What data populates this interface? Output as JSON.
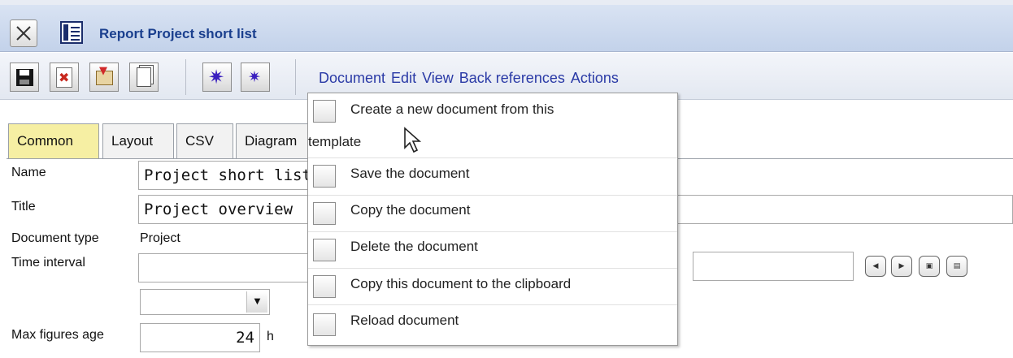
{
  "window": {
    "title": "Report Project short list",
    "close_icon": "close-icon",
    "document_icon": "report-icon"
  },
  "toolbar": {
    "buttons": [
      "save-icon",
      "delete-icon",
      "clipboard-icon",
      "copy-icon",
      "expand-icon",
      "collapse-icon"
    ]
  },
  "menu": {
    "items": [
      "Document",
      "Edit",
      "View",
      "Back references",
      "Actions"
    ]
  },
  "tabs": [
    "Common",
    "Layout",
    "CSV",
    "Diagram"
  ],
  "form": {
    "name_label": "Name",
    "name_value": "Project short list",
    "title_label": "Title",
    "title_value": "Project overview",
    "doc_type_label": "Document type",
    "doc_type_value": "Project",
    "time_interval_label": "Time interval",
    "max_age_label": "Max figures age",
    "max_age_value": "24",
    "max_age_unit": "h"
  },
  "document_menu": {
    "items": [
      {
        "label_line1": "Create a new document from this",
        "label_line2": "template",
        "icon": "template-icon"
      },
      {
        "label": "Save the document",
        "icon": "save-icon"
      },
      {
        "label": "Copy the document",
        "icon": "copy-icon"
      },
      {
        "label": "Delete the document",
        "icon": "delete-icon"
      },
      {
        "label": "Copy this document to the clipboard",
        "icon": "clipboard-icon"
      },
      {
        "label": "Reload document",
        "icon": "reload-icon"
      }
    ]
  },
  "colors": {
    "title_text": "#1a3f8e",
    "menu_text": "#2a3aa6",
    "active_tab": "#f6efa3"
  }
}
